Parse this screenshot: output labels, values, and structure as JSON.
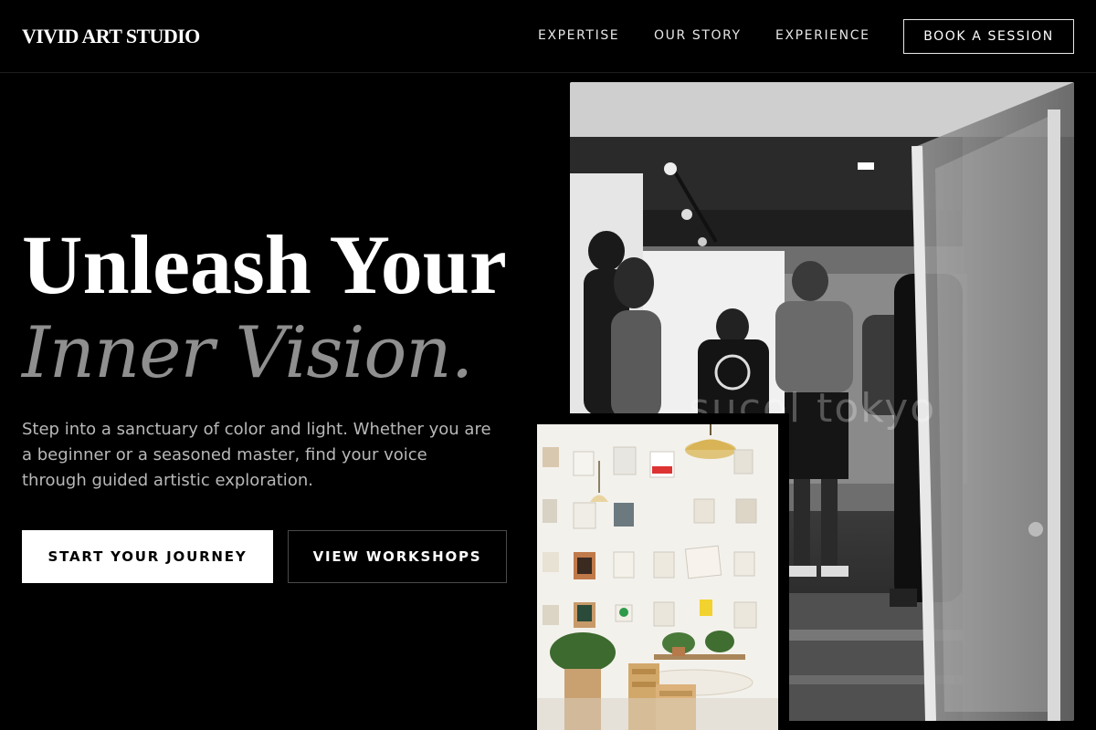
{
  "header": {
    "brand": "VIVID ART STUDIO",
    "nav": [
      {
        "label": "EXPERTISE"
      },
      {
        "label": "OUR STORY"
      },
      {
        "label": "EXPERIENCE"
      }
    ],
    "cta_label": "BOOK A SESSION"
  },
  "hero": {
    "title_line1": "Unleash Your",
    "title_line2": "Inner Vision.",
    "subtitle": "Step into a sanctuary of color and light. Whether you are a beginner or a seasoned master, find your voice through guided artistic exploration.",
    "primary_button": "START YOUR JOURNEY",
    "secondary_button": "VIEW WORKSHOPS"
  },
  "images": {
    "gallery_watermark": "sucol tokyo"
  },
  "colors": {
    "background": "#000000",
    "text": "#ffffff",
    "muted_heading": "#8f8f8f",
    "body_text": "#b8b8b8"
  }
}
